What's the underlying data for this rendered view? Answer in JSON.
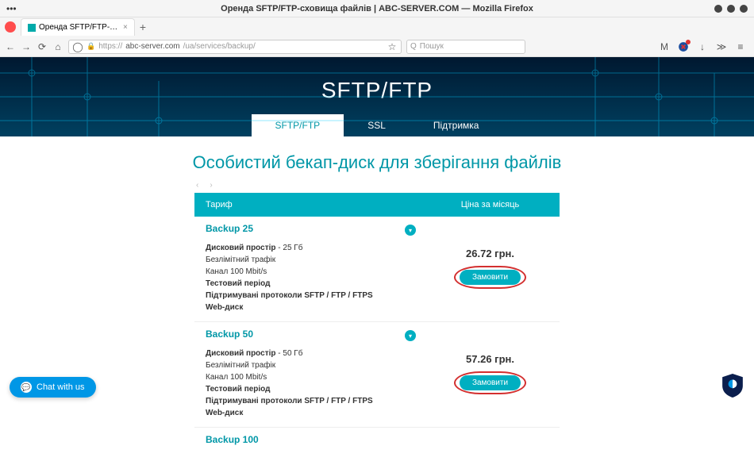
{
  "os": {
    "title": "Оренда SFTP/FTP-сховища файлів | ABC-SERVER.COM — Mozilla Firefox"
  },
  "tab": {
    "title": "Оренда SFTP/FTP-сховищ"
  },
  "url": {
    "prefix": "https://",
    "host": "abc-server.com",
    "path": "/ua/services/backup/"
  },
  "search": {
    "placeholder": "Пошук"
  },
  "hero": {
    "title": "SFTP/FTP",
    "tabs": [
      {
        "label": "SFTP/FTP",
        "active": true
      },
      {
        "label": "SSL",
        "active": false
      },
      {
        "label": "Підтримка",
        "active": false
      }
    ]
  },
  "section_title": "Особистий бекап-диск для зберігання файлів",
  "table": {
    "col1": "Тариф",
    "col2": "Ціна за місяць"
  },
  "plans": [
    {
      "name": "Backup 25",
      "disk_label": "Дисковий простір",
      "disk_value": " - 25 Гб",
      "traffic": "Безлімітний трафік",
      "channel": "Канал 100 Mbit/s",
      "test": "Тестовий період",
      "proto": "Підтримувані протоколи SFTP / FTP / FTPS",
      "webdisk": "Web-диск",
      "price": "26.72 грн.",
      "order": "Замовити"
    },
    {
      "name": "Backup 50",
      "disk_label": "Дисковий простір",
      "disk_value": " - 50 Гб",
      "traffic": "Безлімітний трафік",
      "channel": "Канал 100 Mbit/s",
      "test": "Тестовий період",
      "proto": "Підтримувані протоколи SFTP / FTP / FTPS",
      "webdisk": "Web-диск",
      "price": "57.26 грн.",
      "order": "Замовити"
    },
    {
      "name": "Backup 100"
    }
  ],
  "chat": {
    "label": "Chat with us"
  }
}
